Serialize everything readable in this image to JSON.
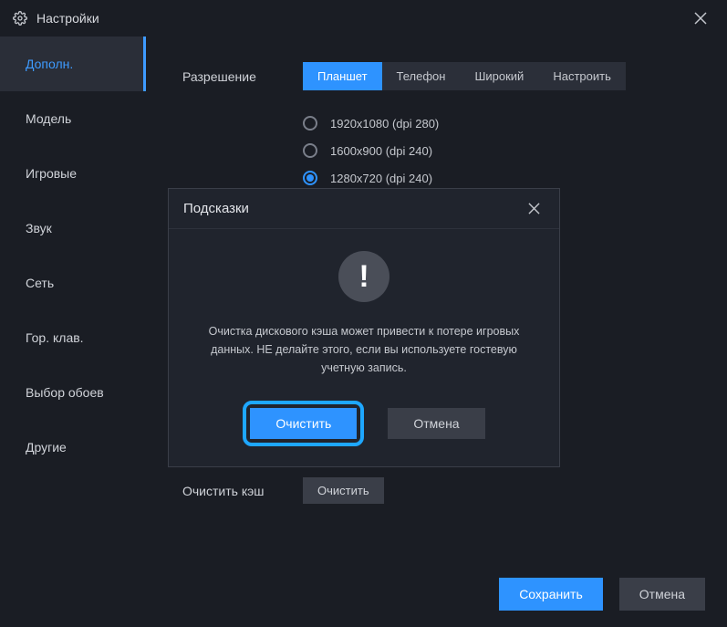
{
  "window": {
    "title": "Настройки"
  },
  "sidebar": {
    "items": [
      {
        "label": "Дополн.",
        "active": true
      },
      {
        "label": "Модель",
        "active": false
      },
      {
        "label": "Игровые",
        "active": false
      },
      {
        "label": "Звук",
        "active": false
      },
      {
        "label": "Сеть",
        "active": false
      },
      {
        "label": "Гор. клав.",
        "active": false
      },
      {
        "label": "Выбор обоев",
        "active": false
      },
      {
        "label": "Другие",
        "active": false
      }
    ]
  },
  "content": {
    "resolution_label": "Разрешение",
    "tabs": [
      {
        "label": "Планшет",
        "active": true
      },
      {
        "label": "Телефон",
        "active": false
      },
      {
        "label": "Широкий",
        "active": false
      },
      {
        "label": "Настроить",
        "active": false
      }
    ],
    "radios": [
      {
        "label": "1920x1080  (dpi 280)",
        "selected": false
      },
      {
        "label": "1600x900  (dpi 240)",
        "selected": false
      },
      {
        "label": "1280x720  (dpi 240)",
        "selected": true
      }
    ],
    "clear_cache_label": "Очистить кэш",
    "clear_button": "Очистить"
  },
  "footer": {
    "save": "Сохранить",
    "cancel": "Отмена"
  },
  "modal": {
    "title": "Подсказки",
    "warn_glyph": "!",
    "message": "Очистка дискового кэша может привести к потере игровых данных. НЕ делайте этого, если вы используете гостевую учетную запись.",
    "confirm": "Очистить",
    "cancel": "Отмена"
  }
}
